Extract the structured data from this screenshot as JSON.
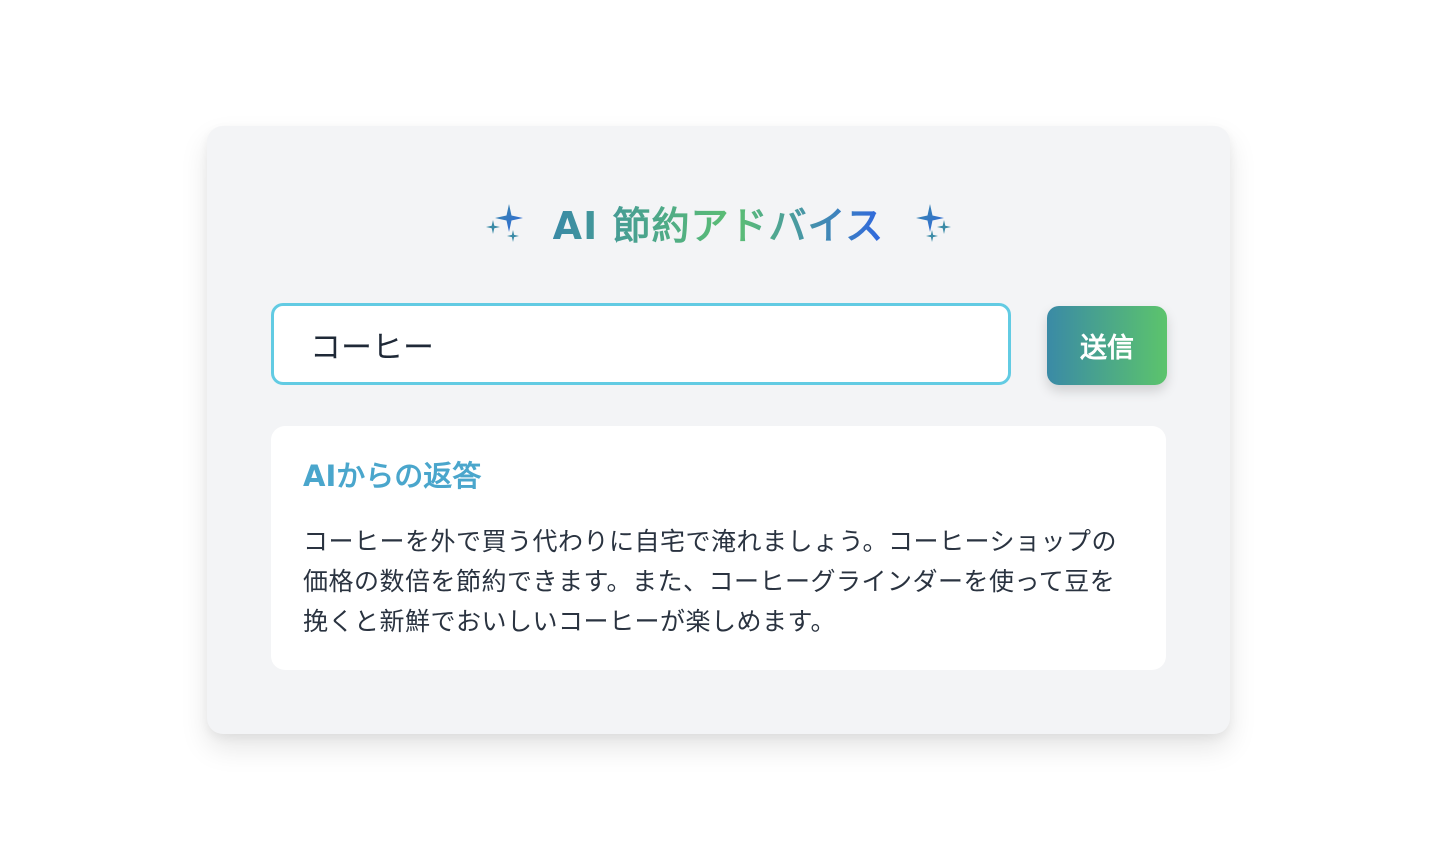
{
  "header": {
    "title": "AI 節約アドバイス",
    "left_icon": "sparkles-icon",
    "right_icon": "sparkles-icon"
  },
  "search": {
    "value": "コーヒー",
    "submit_label": "送信"
  },
  "response": {
    "heading": "AIからの返答",
    "body": "コーヒーを外で買う代わりに自宅で淹れましょう。コーヒーショップの 価格の数倍を節約できます。また、コーヒーグラインダーを使って豆を 挽くと新鮮でおいしいコーヒーが楽しめます。"
  },
  "colors": {
    "accent_start": "#3a8aa6",
    "accent_mid": "#5cbf73",
    "accent_end": "#2f66e0",
    "input_border": "#62cbe3",
    "response_heading": "#4aa6cc",
    "card_bg": "#f3f4f6"
  }
}
